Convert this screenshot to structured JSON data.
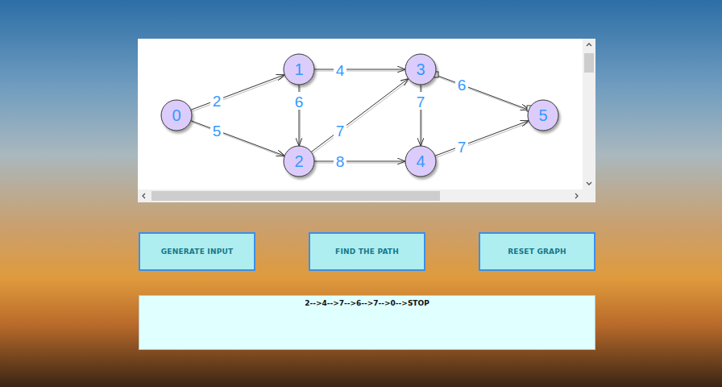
{
  "graph": {
    "nodes": [
      {
        "label": "0"
      },
      {
        "label": "1"
      },
      {
        "label": "2"
      },
      {
        "label": "3"
      },
      {
        "label": "4"
      },
      {
        "label": "5"
      }
    ],
    "edges": [
      {
        "from": 0,
        "to": 1,
        "weight": "2"
      },
      {
        "from": 0,
        "to": 2,
        "weight": "5"
      },
      {
        "from": 1,
        "to": 3,
        "weight": "4"
      },
      {
        "from": 1,
        "to": 2,
        "weight": "6"
      },
      {
        "from": 2,
        "to": 3,
        "weight": "7"
      },
      {
        "from": 2,
        "to": 4,
        "weight": "8"
      },
      {
        "from": 3,
        "to": 4,
        "weight": "7"
      },
      {
        "from": 3,
        "to": 5,
        "weight": "6"
      },
      {
        "from": 4,
        "to": 5,
        "weight": "7"
      }
    ]
  },
  "buttons": [
    "GENERATE INPUT",
    "FIND THE PATH",
    "RESET GRAPH"
  ],
  "output": "2-->4-->7-->6-->7-->0-->STOP"
}
